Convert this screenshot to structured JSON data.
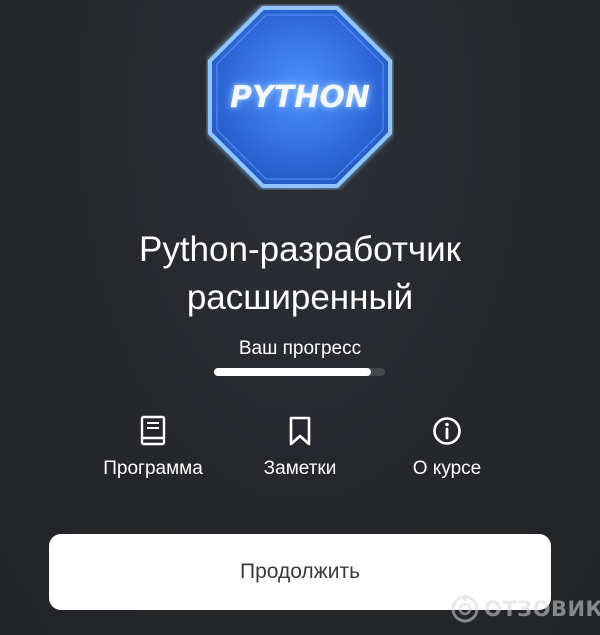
{
  "badge": {
    "text": "PYTHON"
  },
  "course": {
    "title_line1": "Python-разработчик",
    "title_line2": "расширенный"
  },
  "progress": {
    "label": "Ваш прогресс",
    "fraction": 0.92
  },
  "actions": [
    {
      "label": "Программа",
      "icon": "book-icon"
    },
    {
      "label": "Заметки",
      "icon": "bookmark-icon"
    },
    {
      "label": "О курсе",
      "icon": "info-icon"
    }
  ],
  "continue_button": {
    "label": "Продолжить"
  },
  "watermark": {
    "text": "ОТЗОВИК"
  },
  "colors": {
    "background": "#25272b",
    "badge_fill": "#2f6fe0",
    "badge_border": "#8fc4ff",
    "progress_fill": "#ffffff",
    "progress_track": "#44474d",
    "button_bg": "#ffffff",
    "button_text": "#3a3a3a"
  }
}
